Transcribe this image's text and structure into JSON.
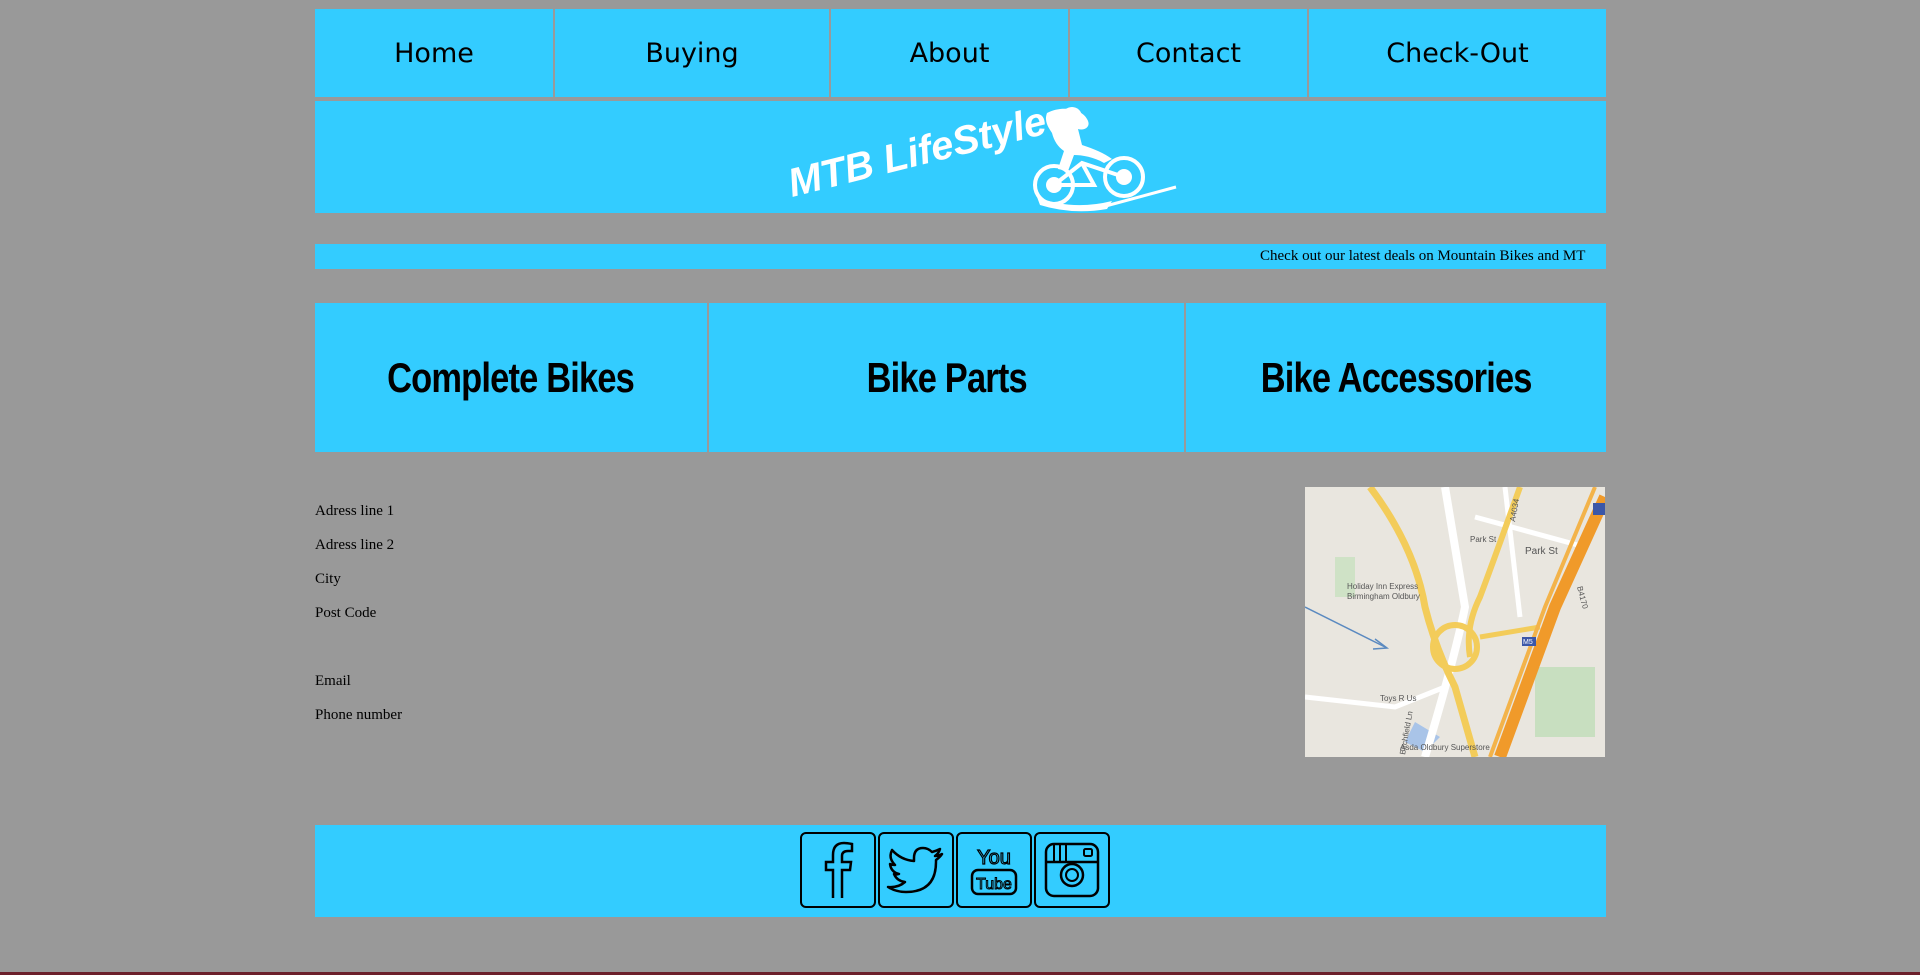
{
  "nav": {
    "items": [
      {
        "label": "Home"
      },
      {
        "label": "Buying"
      },
      {
        "label": "About"
      },
      {
        "label": "Contact"
      },
      {
        "label": "Check-Out"
      }
    ]
  },
  "banner": {
    "logo_text": "MTB LifeStyle"
  },
  "ticker": {
    "text": "Check out our latest deals on Mountain Bikes and MT"
  },
  "categories": [
    {
      "label": "Complete Bikes"
    },
    {
      "label": "Bike Parts"
    },
    {
      "label": "Bike Accessories"
    }
  ],
  "address": {
    "line1": "Adress line 1",
    "line2": "Adress line 2",
    "city": "City",
    "postcode": "Post Code",
    "email": "Email",
    "phone": "Phone number"
  },
  "map": {
    "labels": {
      "park_st_1": "Park St",
      "park_st_2": "Park St",
      "road_a4034": "A4034",
      "holiday_inn_1": "Holiday Inn Express",
      "holiday_inn_2": "Birmingham Oldbury",
      "toys_r_us": "Toys R Us",
      "asda": "Asda Oldbury Superstore",
      "m5": "M5",
      "b4170": "B4170",
      "birchfield": "Birchfield Ln"
    }
  },
  "footer": {
    "social": [
      "facebook-icon",
      "twitter-icon",
      "youtube-icon",
      "instagram-icon"
    ],
    "youtube_you": "You",
    "youtube_tube": "Tube"
  },
  "colors": {
    "accent": "#33ccff",
    "background": "#999999",
    "bottom_line": "#6b1f2a"
  }
}
